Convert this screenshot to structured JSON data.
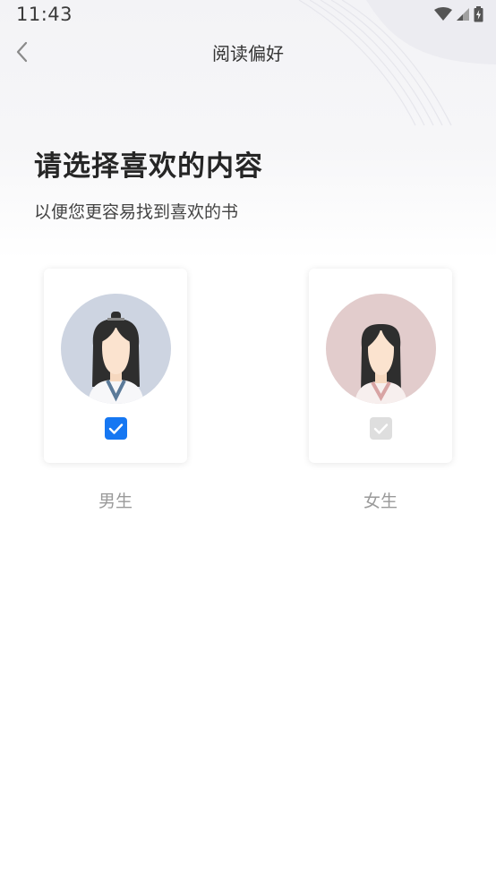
{
  "status_bar": {
    "time": "11:43",
    "icons": [
      "wifi-icon",
      "signal-icon",
      "battery-icon"
    ]
  },
  "nav": {
    "back_icon": "chevron-left-icon",
    "title": "阅读偏好"
  },
  "content": {
    "headline": "请选择喜欢的内容",
    "subtitle": "以便您更容易找到喜欢的书"
  },
  "options": [
    {
      "label": "男生",
      "selected": true,
      "avatar_bg": "#cdd4e1"
    },
    {
      "label": "女生",
      "selected": false,
      "avatar_bg": "#e2cccc"
    }
  ],
  "colors": {
    "accent": "#1677f2",
    "unchecked": "#dedede"
  }
}
